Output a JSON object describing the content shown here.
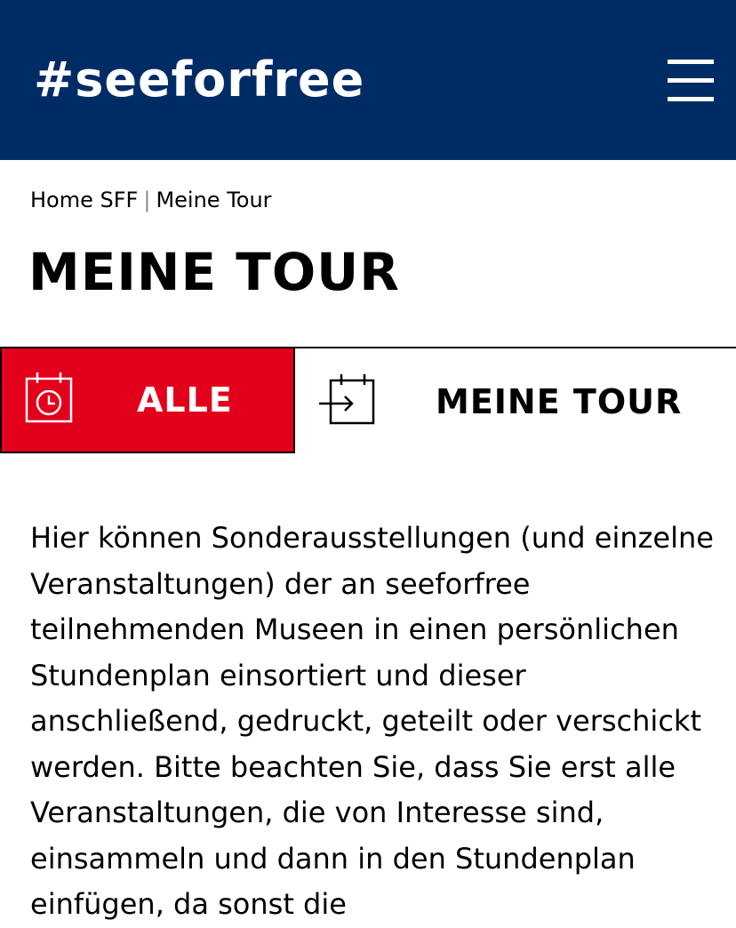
{
  "header": {
    "logo_text": "#seeforfree",
    "background_color": "#002c65",
    "menu_icon": "hamburger-menu-icon"
  },
  "breadcrumb": {
    "home": "Home SFF",
    "separator": "|",
    "current": "Meine Tour"
  },
  "page": {
    "title": "MEINE TOUR"
  },
  "tabs": [
    {
      "label": "ALLE",
      "icon": "calendar-clock-icon",
      "active": true,
      "active_color": "#e2001a"
    },
    {
      "label": "MEINE TOUR",
      "icon": "calendar-arrow-icon",
      "active": false
    }
  ],
  "intro": {
    "text": "Hier können Sonderausstellungen (und einzelne Veranstaltungen) der an seeforfree teilnehmenden Museen in einen persönlichen Stundenplan einsortiert und dieser anschließend, gedruckt, geteilt oder verschickt werden. Bitte beachten Sie, dass Sie erst alle Veranstaltungen, die von Interesse sind, einsammeln und dann in den Stundenplan einfügen, da sonst die"
  }
}
